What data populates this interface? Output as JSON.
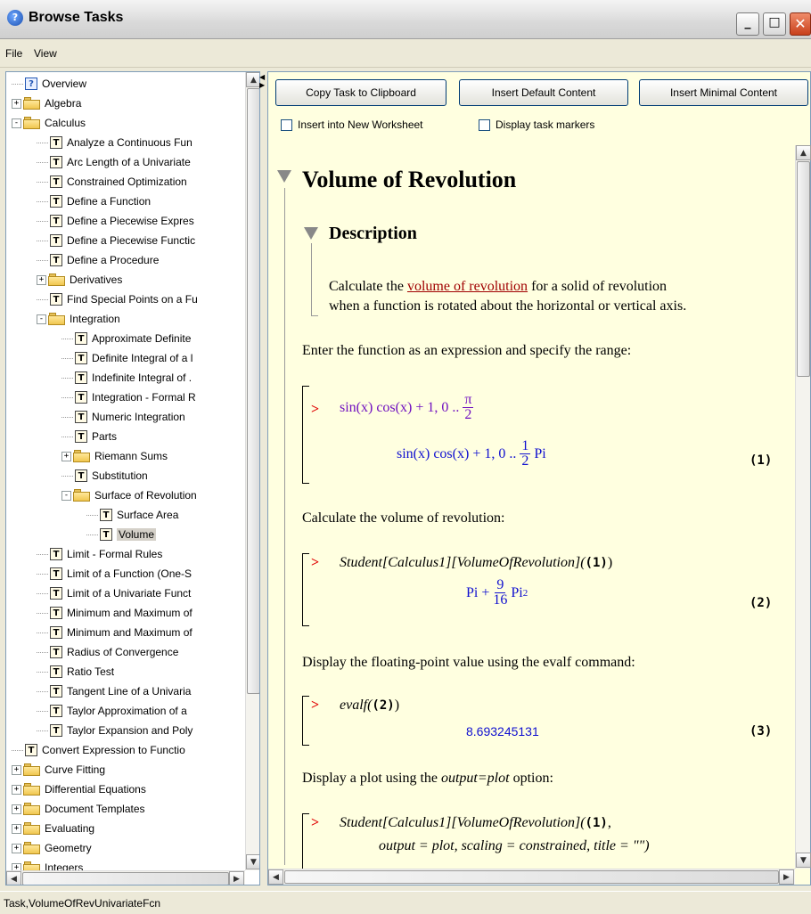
{
  "window": {
    "title": "Browse Tasks",
    "min_glyph": "_",
    "max_glyph": "□",
    "close_glyph": "✕"
  },
  "menu": {
    "file": "File",
    "view": "View"
  },
  "tree": {
    "items": [
      {
        "label": "Overview",
        "depth": 0,
        "kind": "help",
        "exp": ""
      },
      {
        "label": "Algebra",
        "depth": 0,
        "kind": "folder",
        "exp": "+"
      },
      {
        "label": "Calculus",
        "depth": 0,
        "kind": "folder",
        "exp": "-"
      },
      {
        "label": "Analyze a Continuous Fun",
        "depth": 1,
        "kind": "task",
        "exp": ""
      },
      {
        "label": "Arc Length of a Univariate",
        "depth": 1,
        "kind": "task",
        "exp": ""
      },
      {
        "label": "Constrained Optimization",
        "depth": 1,
        "kind": "task",
        "exp": ""
      },
      {
        "label": "Define a Function",
        "depth": 1,
        "kind": "task",
        "exp": ""
      },
      {
        "label": "Define a Piecewise Expres",
        "depth": 1,
        "kind": "task",
        "exp": ""
      },
      {
        "label": "Define a Piecewise Functic",
        "depth": 1,
        "kind": "task",
        "exp": ""
      },
      {
        "label": "Define a Procedure",
        "depth": 1,
        "kind": "task",
        "exp": ""
      },
      {
        "label": "Derivatives",
        "depth": 1,
        "kind": "folder",
        "exp": "+"
      },
      {
        "label": "Find Special Points on a Fu",
        "depth": 1,
        "kind": "task",
        "exp": ""
      },
      {
        "label": "Integration",
        "depth": 1,
        "kind": "folder",
        "exp": "-"
      },
      {
        "label": "Approximate Definite",
        "depth": 2,
        "kind": "task",
        "exp": ""
      },
      {
        "label": "Definite Integral of a l",
        "depth": 2,
        "kind": "task",
        "exp": ""
      },
      {
        "label": "Indefinite Integral of .",
        "depth": 2,
        "kind": "task",
        "exp": ""
      },
      {
        "label": "Integration - Formal R",
        "depth": 2,
        "kind": "task",
        "exp": ""
      },
      {
        "label": "Numeric Integration",
        "depth": 2,
        "kind": "task",
        "exp": ""
      },
      {
        "label": "Parts",
        "depth": 2,
        "kind": "task",
        "exp": ""
      },
      {
        "label": "Riemann Sums",
        "depth": 2,
        "kind": "folder",
        "exp": "+"
      },
      {
        "label": "Substitution",
        "depth": 2,
        "kind": "task",
        "exp": ""
      },
      {
        "label": "Surface of Revolution",
        "depth": 2,
        "kind": "folder",
        "exp": "-"
      },
      {
        "label": "Surface Area",
        "depth": 3,
        "kind": "task",
        "exp": ""
      },
      {
        "label": "Volume",
        "depth": 3,
        "kind": "task",
        "exp": "",
        "selected": true
      },
      {
        "label": "Limit - Formal Rules",
        "depth": 1,
        "kind": "task",
        "exp": ""
      },
      {
        "label": "Limit of a Function (One-S",
        "depth": 1,
        "kind": "task",
        "exp": ""
      },
      {
        "label": "Limit of a Univariate Funct",
        "depth": 1,
        "kind": "task",
        "exp": ""
      },
      {
        "label": "Minimum and Maximum of",
        "depth": 1,
        "kind": "task",
        "exp": ""
      },
      {
        "label": "Minimum and Maximum of",
        "depth": 1,
        "kind": "task",
        "exp": ""
      },
      {
        "label": "Radius of Convergence",
        "depth": 1,
        "kind": "task",
        "exp": ""
      },
      {
        "label": "Ratio Test",
        "depth": 1,
        "kind": "task",
        "exp": ""
      },
      {
        "label": "Tangent Line of a Univaria",
        "depth": 1,
        "kind": "task",
        "exp": ""
      },
      {
        "label": "Taylor Approximation of a",
        "depth": 1,
        "kind": "task",
        "exp": ""
      },
      {
        "label": "Taylor Expansion and Poly",
        "depth": 1,
        "kind": "task",
        "exp": ""
      },
      {
        "label": "Convert Expression to Functio",
        "depth": 0,
        "kind": "task",
        "exp": ""
      },
      {
        "label": "Curve Fitting",
        "depth": 0,
        "kind": "folder",
        "exp": "+"
      },
      {
        "label": "Differential Equations",
        "depth": 0,
        "kind": "folder",
        "exp": "+"
      },
      {
        "label": "Document Templates",
        "depth": 0,
        "kind": "folder",
        "exp": "+"
      },
      {
        "label": "Evaluating",
        "depth": 0,
        "kind": "folder",
        "exp": "+"
      },
      {
        "label": "Geometry",
        "depth": 0,
        "kind": "folder",
        "exp": "+"
      },
      {
        "label": "Integers",
        "depth": 0,
        "kind": "folder",
        "exp": "+"
      }
    ]
  },
  "toolbar": {
    "copy": "Copy Task to Clipboard",
    "insert_default": "Insert Default Content",
    "insert_minimal": "Insert Minimal Content",
    "new_worksheet": "Insert into New Worksheet",
    "task_markers": "Display task markers"
  },
  "worksheet": {
    "heading": "Volume of Revolution",
    "subheading": "Description",
    "desc_pre": "Calculate the ",
    "desc_link": "volume of revolution",
    "desc_post1": " for a solid of revolution",
    "desc_post2": "when a function is rotated about the horizontal or vertical axis.",
    "p1": "Enter the function as an expression and specify the range:",
    "p2": "Calculate the volume of revolution:",
    "p3": "Display the floating-point value using the evalf command:",
    "p4_pre": "Display a plot using the ",
    "p4_em": "output=plot",
    "p4_post": " option:",
    "prompt": ">",
    "in1_expr": "sin(x) cos(x) + 1, 0 ..",
    "pi": "π",
    "two": "2",
    "out1_expr": "sin(x) cos(x) + 1, 0 ..",
    "one": "1",
    "pi_word": "Pi",
    "label1": "(1)",
    "in2_expr": "Student[Calculus1][VolumeOfRevolution](",
    "in2_ref": "(1)",
    "in2_close": ")",
    "out2_pre": "Pi +",
    "nine": "9",
    "sixteen": "16",
    "out2_post": "Pi",
    "sq": "2",
    "label2": "(2)",
    "in3_expr": "evalf(",
    "in3_ref": "(2)",
    "in3_close": ")",
    "out3": "8.693245131",
    "label3": "(3)",
    "in4_expr": "Student[Calculus1][VolumeOfRevolution](",
    "in4_ref": "(1)",
    "in4_comma": ",",
    "in4_line2": "output = plot, scaling = constrained, title = \"\")"
  },
  "status": {
    "text": "Task,VolumeOfRevUnivariateFcn"
  },
  "colors": {
    "background": "#ffffe0",
    "prompt": "#e00000",
    "output": "#1010d0",
    "input_math": "#7010c0",
    "link": "#a00000"
  }
}
